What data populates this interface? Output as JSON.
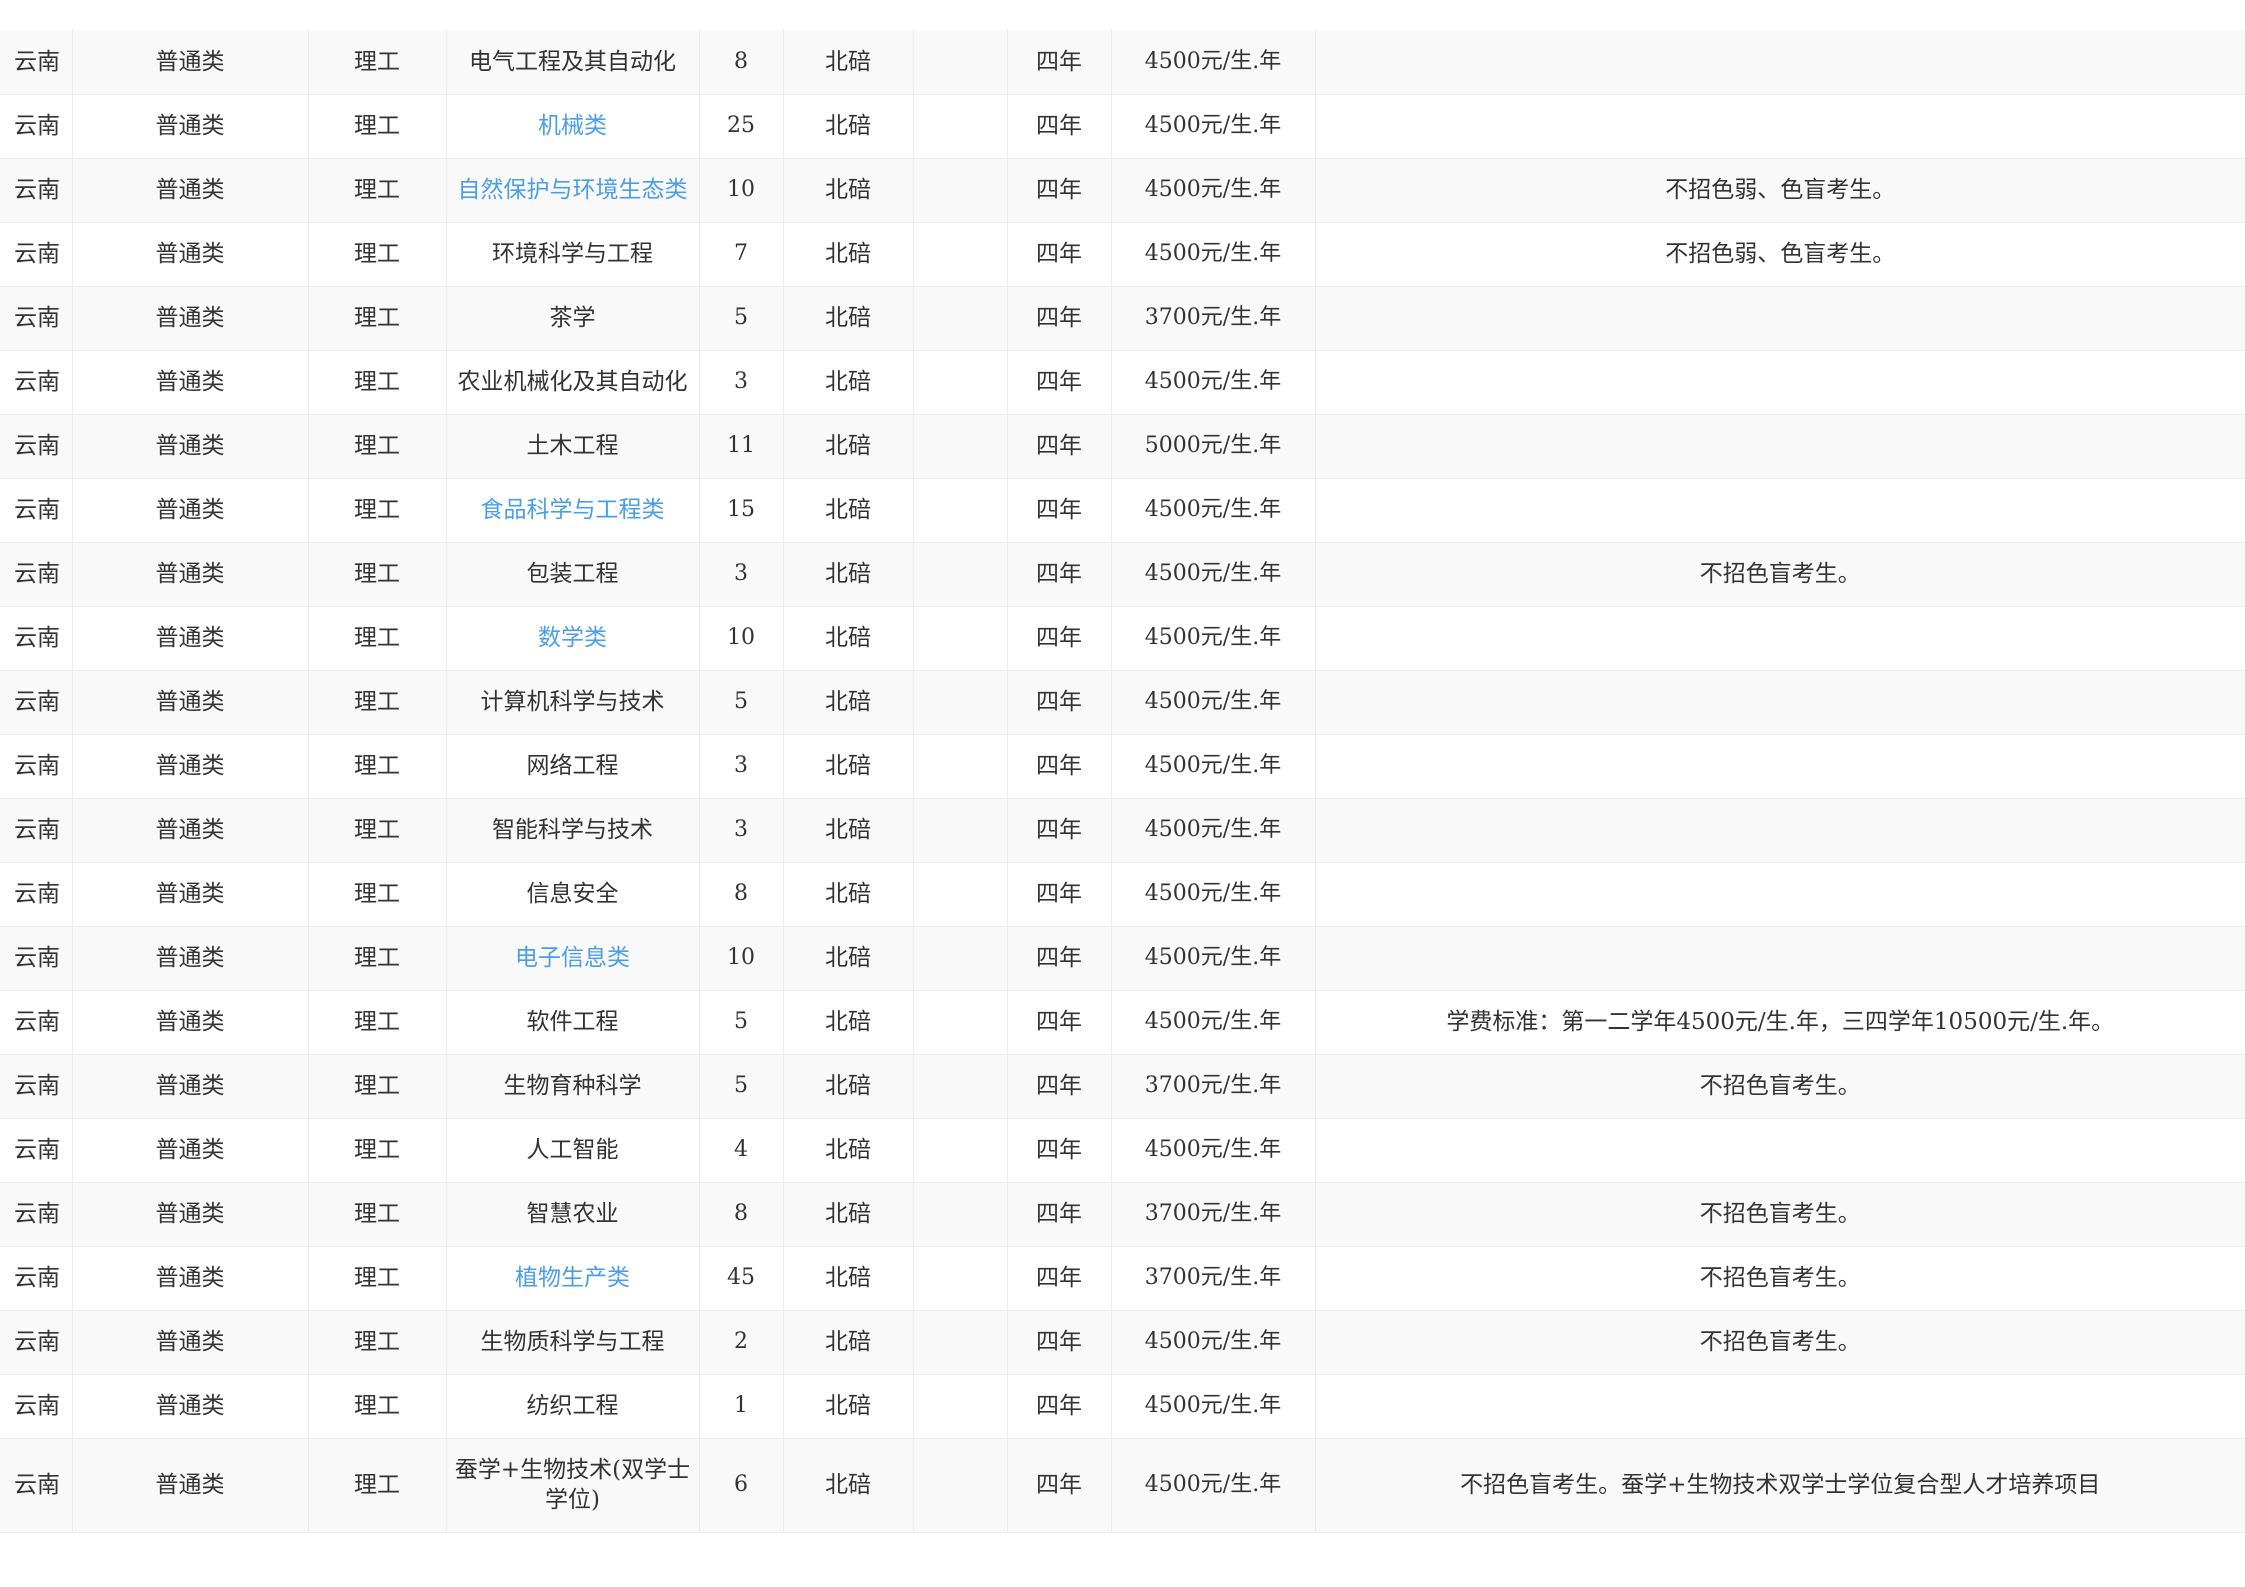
{
  "rows": [
    {
      "province": "云南",
      "type": "普通类",
      "category": "理工",
      "major": "电气工程及其自动化",
      "link": false,
      "plan": "8",
      "campus": "北碚",
      "blank": "",
      "years": "四年",
      "fee": "4500元/生.年",
      "note": ""
    },
    {
      "province": "云南",
      "type": "普通类",
      "category": "理工",
      "major": "机械类",
      "link": true,
      "plan": "25",
      "campus": "北碚",
      "blank": "",
      "years": "四年",
      "fee": "4500元/生.年",
      "note": ""
    },
    {
      "province": "云南",
      "type": "普通类",
      "category": "理工",
      "major": "自然保护与环境生态类",
      "link": true,
      "plan": "10",
      "campus": "北碚",
      "blank": "",
      "years": "四年",
      "fee": "4500元/生.年",
      "note": "不招色弱、色盲考生。"
    },
    {
      "province": "云南",
      "type": "普通类",
      "category": "理工",
      "major": "环境科学与工程",
      "link": false,
      "plan": "7",
      "campus": "北碚",
      "blank": "",
      "years": "四年",
      "fee": "4500元/生.年",
      "note": "不招色弱、色盲考生。"
    },
    {
      "province": "云南",
      "type": "普通类",
      "category": "理工",
      "major": "茶学",
      "link": false,
      "plan": "5",
      "campus": "北碚",
      "blank": "",
      "years": "四年",
      "fee": "3700元/生.年",
      "note": ""
    },
    {
      "province": "云南",
      "type": "普通类",
      "category": "理工",
      "major": "农业机械化及其自动化",
      "link": false,
      "plan": "3",
      "campus": "北碚",
      "blank": "",
      "years": "四年",
      "fee": "4500元/生.年",
      "note": ""
    },
    {
      "province": "云南",
      "type": "普通类",
      "category": "理工",
      "major": "土木工程",
      "link": false,
      "plan": "11",
      "campus": "北碚",
      "blank": "",
      "years": "四年",
      "fee": "5000元/生.年",
      "note": ""
    },
    {
      "province": "云南",
      "type": "普通类",
      "category": "理工",
      "major": "食品科学与工程类",
      "link": true,
      "plan": "15",
      "campus": "北碚",
      "blank": "",
      "years": "四年",
      "fee": "4500元/生.年",
      "note": ""
    },
    {
      "province": "云南",
      "type": "普通类",
      "category": "理工",
      "major": "包装工程",
      "link": false,
      "plan": "3",
      "campus": "北碚",
      "blank": "",
      "years": "四年",
      "fee": "4500元/生.年",
      "note": "不招色盲考生。"
    },
    {
      "province": "云南",
      "type": "普通类",
      "category": "理工",
      "major": "数学类",
      "link": true,
      "plan": "10",
      "campus": "北碚",
      "blank": "",
      "years": "四年",
      "fee": "4500元/生.年",
      "note": ""
    },
    {
      "province": "云南",
      "type": "普通类",
      "category": "理工",
      "major": "计算机科学与技术",
      "link": false,
      "plan": "5",
      "campus": "北碚",
      "blank": "",
      "years": "四年",
      "fee": "4500元/生.年",
      "note": ""
    },
    {
      "province": "云南",
      "type": "普通类",
      "category": "理工",
      "major": "网络工程",
      "link": false,
      "plan": "3",
      "campus": "北碚",
      "blank": "",
      "years": "四年",
      "fee": "4500元/生.年",
      "note": ""
    },
    {
      "province": "云南",
      "type": "普通类",
      "category": "理工",
      "major": "智能科学与技术",
      "link": false,
      "plan": "3",
      "campus": "北碚",
      "blank": "",
      "years": "四年",
      "fee": "4500元/生.年",
      "note": ""
    },
    {
      "province": "云南",
      "type": "普通类",
      "category": "理工",
      "major": "信息安全",
      "link": false,
      "plan": "8",
      "campus": "北碚",
      "blank": "",
      "years": "四年",
      "fee": "4500元/生.年",
      "note": ""
    },
    {
      "province": "云南",
      "type": "普通类",
      "category": "理工",
      "major": "电子信息类",
      "link": true,
      "plan": "10",
      "campus": "北碚",
      "blank": "",
      "years": "四年",
      "fee": "4500元/生.年",
      "note": ""
    },
    {
      "province": "云南",
      "type": "普通类",
      "category": "理工",
      "major": "软件工程",
      "link": false,
      "plan": "5",
      "campus": "北碚",
      "blank": "",
      "years": "四年",
      "fee": "4500元/生.年",
      "note": "学费标准：第一二学年4500元/生.年，三四学年10500元/生.年。"
    },
    {
      "province": "云南",
      "type": "普通类",
      "category": "理工",
      "major": "生物育种科学",
      "link": false,
      "plan": "5",
      "campus": "北碚",
      "blank": "",
      "years": "四年",
      "fee": "3700元/生.年",
      "note": "不招色盲考生。"
    },
    {
      "province": "云南",
      "type": "普通类",
      "category": "理工",
      "major": "人工智能",
      "link": false,
      "plan": "4",
      "campus": "北碚",
      "blank": "",
      "years": "四年",
      "fee": "4500元/生.年",
      "note": ""
    },
    {
      "province": "云南",
      "type": "普通类",
      "category": "理工",
      "major": "智慧农业",
      "link": false,
      "plan": "8",
      "campus": "北碚",
      "blank": "",
      "years": "四年",
      "fee": "3700元/生.年",
      "note": "不招色盲考生。"
    },
    {
      "province": "云南",
      "type": "普通类",
      "category": "理工",
      "major": "植物生产类",
      "link": true,
      "plan": "45",
      "campus": "北碚",
      "blank": "",
      "years": "四年",
      "fee": "3700元/生.年",
      "note": "不招色盲考生。"
    },
    {
      "province": "云南",
      "type": "普通类",
      "category": "理工",
      "major": "生物质科学与工程",
      "link": false,
      "plan": "2",
      "campus": "北碚",
      "blank": "",
      "years": "四年",
      "fee": "4500元/生.年",
      "note": "不招色盲考生。"
    },
    {
      "province": "云南",
      "type": "普通类",
      "category": "理工",
      "major": "纺织工程",
      "link": false,
      "plan": "1",
      "campus": "北碚",
      "blank": "",
      "years": "四年",
      "fee": "4500元/生.年",
      "note": ""
    },
    {
      "province": "云南",
      "type": "普通类",
      "category": "理工",
      "major": "蚕学+生物技术(双学士学位)",
      "link": false,
      "plan": "6",
      "campus": "北碚",
      "blank": "",
      "years": "四年",
      "fee": "4500元/生.年",
      "note": "不招色盲考生。蚕学+生物技术双学士学位复合型人才培养项目"
    }
  ],
  "colors": {
    "link": "#4a9ee8",
    "text": "#333333",
    "border": "#ececec",
    "stripe": "#f9f9f9"
  }
}
